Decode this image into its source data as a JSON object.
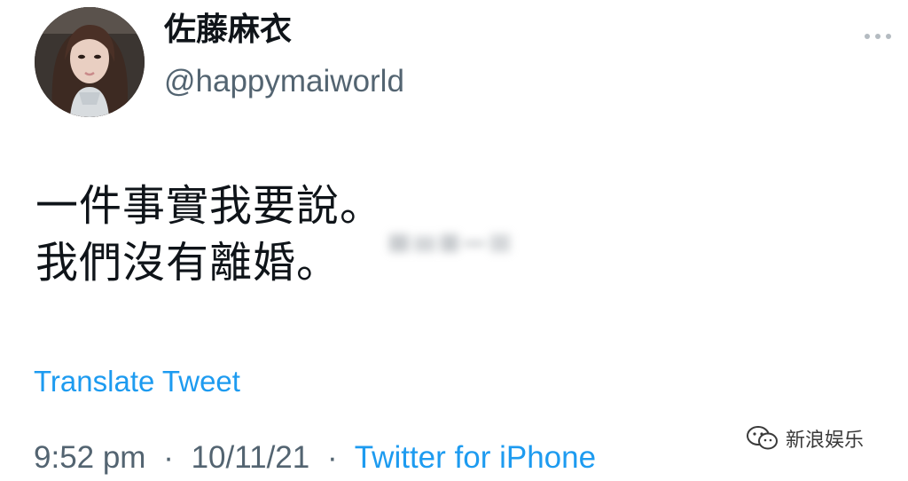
{
  "tweet": {
    "display_name": "佐藤麻衣",
    "handle": "@happymaiworld",
    "text_lines": [
      "一件事實我要說。",
      "我們沒有離婚。"
    ],
    "translate_label": "Translate Tweet",
    "time": "9:52 pm",
    "date": "10/11/21",
    "separator": "·",
    "source": "Twitter for iPhone",
    "more_icon": "more-horizontal-icon"
  },
  "watermark": {
    "icon": "wechat-icon",
    "text": "新浪娱乐"
  },
  "colors": {
    "link": "#1d9bf0",
    "secondary": "#536471",
    "primary": "#0f1419"
  }
}
